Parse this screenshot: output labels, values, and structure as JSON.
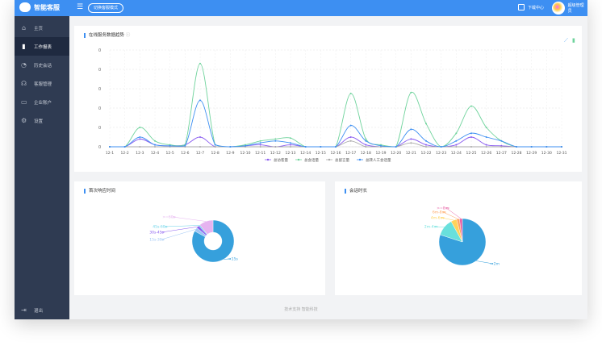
{
  "header": {
    "app_name": "智能客服",
    "mode_button": "切换客服模式",
    "download_center": "下载中心",
    "username": "超级管理员"
  },
  "sidebar": {
    "items": [
      {
        "label": "主页",
        "icon": "home-icon"
      },
      {
        "label": "工作报表",
        "icon": "bar-chart-icon",
        "active": true
      },
      {
        "label": "历史会话",
        "icon": "clock-icon"
      },
      {
        "label": "客服管理",
        "icon": "headset-icon"
      },
      {
        "label": "企业账户",
        "icon": "id-card-icon"
      },
      {
        "label": "设置",
        "icon": "gear-icon"
      }
    ],
    "logout": "退出"
  },
  "trend": {
    "title": "在线服务数据趋势"
  },
  "pie1": {
    "title": "首次响应时间"
  },
  "pie2": {
    "title": "会话时长"
  },
  "footer": "技术支持 智能科技",
  "chart_data": [
    {
      "type": "line",
      "smooth": true,
      "grid": true,
      "legend": "bottom",
      "ylim": [
        0,
        5
      ],
      "ytick_labels": [
        "0",
        "0",
        "0",
        "0",
        "0",
        "0"
      ],
      "categories": [
        "12-1",
        "12-2",
        "12-3",
        "12-4",
        "12-5",
        "12-6",
        "12-7",
        "12-8",
        "12-9",
        "12-10",
        "12-11",
        "12-12",
        "12-13",
        "12-14",
        "12-15",
        "12-16",
        "12-17",
        "12-18",
        "12-19",
        "12-20",
        "12-21",
        "12-22",
        "12-23",
        "12-24",
        "12-25",
        "12-26",
        "12-27",
        "12-28",
        "12-29",
        "12-30",
        "12-31"
      ],
      "series": [
        {
          "name": "总访客量",
          "color": "#8a5cf0",
          "values": [
            0,
            0,
            0.4,
            0.1,
            0.05,
            0.1,
            0.5,
            0,
            0,
            0.05,
            0.1,
            0,
            0.1,
            0,
            0,
            0,
            0.5,
            0.1,
            0,
            0,
            0.4,
            0.1,
            0,
            0.1,
            0.5,
            0.1,
            0.05,
            0,
            0,
            0,
            0
          ]
        },
        {
          "name": "总会话量",
          "color": "#6fd39c",
          "values": [
            0,
            0,
            1.0,
            0.3,
            0.1,
            0.1,
            4.3,
            0.1,
            0,
            0.1,
            0.3,
            0.4,
            0.45,
            0,
            0,
            0,
            2.75,
            0.4,
            0.1,
            0,
            2.8,
            1.2,
            0,
            0.7,
            2.1,
            1.0,
            0.3,
            0,
            0,
            0,
            0
          ]
        },
        {
          "name": "总留言量",
          "color": "#aaaaaa",
          "values": [
            0,
            0,
            0,
            0,
            0,
            0,
            0,
            0,
            0,
            0,
            0,
            0,
            0,
            0,
            0,
            0,
            0.3,
            0,
            0,
            0,
            0.2,
            0,
            0,
            0,
            0,
            0,
            0,
            0,
            0,
            0,
            0
          ]
        },
        {
          "name": "总转人工会话量",
          "color": "#3d8ff2",
          "values": [
            0,
            0,
            0.5,
            0.1,
            0.05,
            0.05,
            2.4,
            0.1,
            0,
            0.05,
            0.2,
            0.3,
            0.2,
            0,
            0,
            0,
            1.1,
            0.3,
            0.05,
            0,
            0.9,
            0.3,
            0,
            0.3,
            0.7,
            0.5,
            0.3,
            0,
            0,
            0,
            0
          ]
        }
      ]
    },
    {
      "type": "pie",
      "donut": true,
      "labels": [
        "<15s",
        "15s-30s",
        "30s-45s",
        "45s-60s",
        ">=60s"
      ],
      "values": [
        83,
        3,
        2,
        1,
        11
      ],
      "colors": [
        "#36a0dc",
        "#9ec6f5",
        "#8a5cf0",
        "#68d3e8",
        "#e6b3f0"
      ]
    },
    {
      "type": "pie",
      "labels": [
        "<2m",
        "2m-4m",
        "4m-6m",
        "6m-8m",
        ">=8m"
      ],
      "values": [
        80,
        12,
        4,
        2,
        2
      ],
      "colors": [
        "#36a0dc",
        "#68e0dc",
        "#ffd25a",
        "#ffa560",
        "#e863a6"
      ]
    }
  ]
}
